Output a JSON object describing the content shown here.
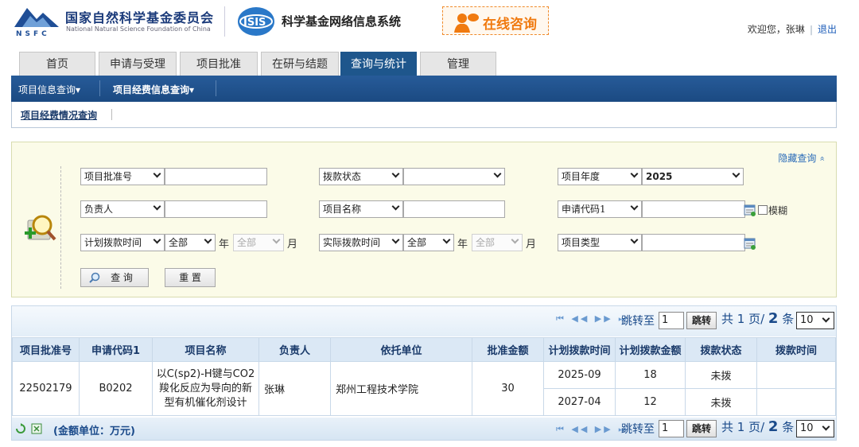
{
  "header": {
    "org_cn": "国家自然科学基金委员会",
    "org_en": "National Natural Science Foundation of China",
    "nsfc_letters": "NSFC",
    "isis_logo_text": "ISIS",
    "system_name": "科学基金网络信息系统",
    "consult_label": "在线咨询",
    "welcome": "欢迎您，张琳",
    "separator": "|",
    "logout": "退出"
  },
  "tabs": [
    {
      "label": "首页"
    },
    {
      "label": "申请与受理"
    },
    {
      "label": "项目批准"
    },
    {
      "label": "在研与结题"
    },
    {
      "label": "查询与统计",
      "active": true
    },
    {
      "label": "管理"
    }
  ],
  "subnav": {
    "items": [
      "项目信息查询",
      "项目经费信息查询"
    ],
    "arrow": "▾"
  },
  "breadcrumb": {
    "link": "项目经费情况查询"
  },
  "query": {
    "hide_label": "隐藏查询",
    "hide_arrow": "»",
    "row1": {
      "f1_select": "项目批准号",
      "f1_value": "",
      "f2_select": "拨款状态",
      "f2_value": "",
      "f3_select": "项目年度",
      "f3_value": "2025"
    },
    "row2": {
      "f1_select": "负责人",
      "f1_value": "",
      "f2_select": "项目名称",
      "f2_value": "",
      "f3_select": "申请代码1",
      "f3_value": "",
      "fuzzy_label": "模糊"
    },
    "row3": {
      "plan_select": "计划拨款时间",
      "plan_year": "全部",
      "year_unit": "年",
      "plan_month": "全部",
      "month_unit": "月",
      "actual_select": "实际拨款时间",
      "actual_year": "全部",
      "actual_month": "全部",
      "type_select": "项目类型",
      "type_value": ""
    },
    "search_button": "查 询",
    "reset_button": "重 置"
  },
  "pager": {
    "jump_label": "跳转至",
    "page_value": "1",
    "jump_button": "跳转",
    "info_prefix": "共 1 页/",
    "info_count": "2",
    "info_suffix": "条",
    "page_size": "10"
  },
  "table": {
    "columns": [
      "项目批准号",
      "申请代码1",
      "项目名称",
      "负责人",
      "依托单位",
      "批准金额",
      "计划拨款时间",
      "计划拨款金额",
      "拨款状态",
      "拨款时间"
    ],
    "row": {
      "approval_no": "22502179",
      "code": "B0202",
      "name": "以C(sp2)-H键与CO2羧化反应为导向的新型有机催化剂设计",
      "leader": "张琳",
      "institution": "郑州工程技术学院",
      "amount": "30",
      "plans": [
        {
          "time": "2025-09",
          "amount": "18",
          "status": "未拨",
          "paid_time": ""
        },
        {
          "time": "2027-04",
          "amount": "12",
          "status": "未拨",
          "paid_time": ""
        }
      ]
    }
  },
  "footer": {
    "unit_note": "(金额单位：万元)"
  }
}
